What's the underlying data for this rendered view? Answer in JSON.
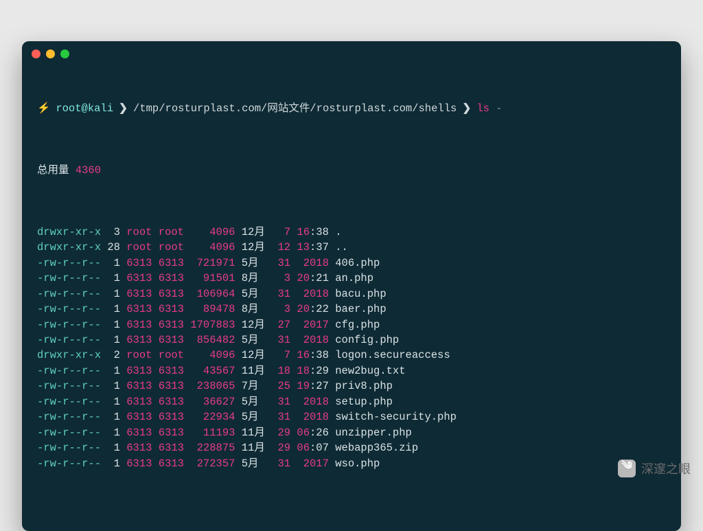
{
  "prompt": {
    "bolt": "⚡",
    "user": "root@kali",
    "sep": "❯",
    "path": "/tmp/rosturplast.com/网站文件/rosturplast.com/shells",
    "cmd": "ls",
    "flag": "-"
  },
  "total": {
    "label": "总用量",
    "value": "4360"
  },
  "rows": [
    {
      "perm": "drwxr-xr-x",
      "links": "3",
      "owner": "root",
      "group": "root",
      "size": "4096",
      "month": "12月",
      "day": "7",
      "t1": "16",
      "t2": ":38",
      "name": ".",
      "dir": true
    },
    {
      "perm": "drwxr-xr-x",
      "links": "28",
      "owner": "root",
      "group": "root",
      "size": "4096",
      "month": "12月",
      "day": "12",
      "t1": "13",
      "t2": ":37",
      "name": "..",
      "dir": true
    },
    {
      "perm": "-rw-r--r--",
      "links": "1",
      "owner": "6313",
      "group": "6313",
      "size": "721971",
      "month": "5月",
      "day": "31",
      "t1": "2018",
      "t2": "",
      "name": "406.php"
    },
    {
      "perm": "-rw-r--r--",
      "links": "1",
      "owner": "6313",
      "group": "6313",
      "size": "91501",
      "month": "8月",
      "day": "3",
      "t1": "20",
      "t2": ":21",
      "name": "an.php"
    },
    {
      "perm": "-rw-r--r--",
      "links": "1",
      "owner": "6313",
      "group": "6313",
      "size": "106964",
      "month": "5月",
      "day": "31",
      "t1": "2018",
      "t2": "",
      "name": "bacu.php"
    },
    {
      "perm": "-rw-r--r--",
      "links": "1",
      "owner": "6313",
      "group": "6313",
      "size": "89478",
      "month": "8月",
      "day": "3",
      "t1": "20",
      "t2": ":22",
      "name": "baer.php"
    },
    {
      "perm": "-rw-r--r--",
      "links": "1",
      "owner": "6313",
      "group": "6313",
      "size": "1707883",
      "month": "12月",
      "day": "27",
      "t1": "2017",
      "t2": "",
      "name": "cfg.php"
    },
    {
      "perm": "-rw-r--r--",
      "links": "1",
      "owner": "6313",
      "group": "6313",
      "size": "856482",
      "month": "5月",
      "day": "31",
      "t1": "2018",
      "t2": "",
      "name": "config.php"
    },
    {
      "perm": "drwxr-xr-x",
      "links": "2",
      "owner": "root",
      "group": "root",
      "size": "4096",
      "month": "12月",
      "day": "7",
      "t1": "16",
      "t2": ":38",
      "name": "logon.secureaccess",
      "dir": true
    },
    {
      "perm": "-rw-r--r--",
      "links": "1",
      "owner": "6313",
      "group": "6313",
      "size": "43567",
      "month": "11月",
      "day": "18",
      "t1": "18",
      "t2": ":29",
      "name": "new2bug.txt"
    },
    {
      "perm": "-rw-r--r--",
      "links": "1",
      "owner": "6313",
      "group": "6313",
      "size": "238065",
      "month": "7月",
      "day": "25",
      "t1": "19",
      "t2": ":27",
      "name": "priv8.php"
    },
    {
      "perm": "-rw-r--r--",
      "links": "1",
      "owner": "6313",
      "group": "6313",
      "size": "36627",
      "month": "5月",
      "day": "31",
      "t1": "2018",
      "t2": "",
      "name": "setup.php"
    },
    {
      "perm": "-rw-r--r--",
      "links": "1",
      "owner": "6313",
      "group": "6313",
      "size": "22934",
      "month": "5月",
      "day": "31",
      "t1": "2018",
      "t2": "",
      "name": "switch-security.php"
    },
    {
      "perm": "-rw-r--r--",
      "links": "1",
      "owner": "6313",
      "group": "6313",
      "size": "11193",
      "month": "11月",
      "day": "29",
      "t1": "06",
      "t2": ":26",
      "name": "unzipper.php"
    },
    {
      "perm": "-rw-r--r--",
      "links": "1",
      "owner": "6313",
      "group": "6313",
      "size": "228875",
      "month": "11月",
      "day": "29",
      "t1": "06",
      "t2": ":07",
      "name": "webapp365.zip"
    },
    {
      "perm": "-rw-r--r--",
      "links": "1",
      "owner": "6313",
      "group": "6313",
      "size": "272357",
      "month": "5月",
      "day": "31",
      "t1": "2017",
      "t2": "",
      "name": "wso.php"
    }
  ],
  "watermark": {
    "text": "深邃之眼",
    "icon": "༄"
  }
}
